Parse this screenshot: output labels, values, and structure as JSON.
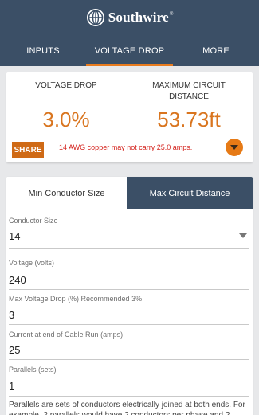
{
  "header": {
    "brand": "Southwire",
    "brand_mark": "®",
    "logo_icon": "southwire-globe-icon"
  },
  "tabs": [
    {
      "label": "INPUTS",
      "active": false
    },
    {
      "label": "VOLTAGE DROP",
      "active": true
    },
    {
      "label": "MORE",
      "active": false
    }
  ],
  "colors": {
    "header_bg": "#3b4f66",
    "accent": "#e87b1e",
    "result_value": "#d9751f",
    "warning": "#d4221c"
  },
  "results": {
    "voltage_drop_label": "VOLTAGE DROP",
    "voltage_drop_value": "3.0%",
    "max_distance_label": "MAXIMUM CIRCUIT DISTANCE",
    "max_distance_value": "53.73ft",
    "share_label": "SHARE",
    "warning": "14 AWG copper may not carry 25.0 amps.",
    "expand_icon": "chevron-down-icon"
  },
  "mode_toggle": {
    "options": [
      "Min Conductor Size",
      "Max Circuit Distance"
    ],
    "selected": "Max Circuit Distance"
  },
  "form": {
    "conductor_size_label": "Conductor Size",
    "conductor_size_value": "14",
    "voltage_label": "Voltage (volts)",
    "voltage_value": "240",
    "max_drop_label": "Max Voltage Drop (%) Recommended 3%",
    "max_drop_value": "3",
    "current_label": "Current at end of Cable Run (amps)",
    "current_value": "25",
    "parallels_label": "Parallels (sets)",
    "parallels_value": "1",
    "parallels_note": "Parallels are sets of conductors electrically joined at both ends. For example, 2 parallels would have 2 conductors per phase and 2"
  }
}
